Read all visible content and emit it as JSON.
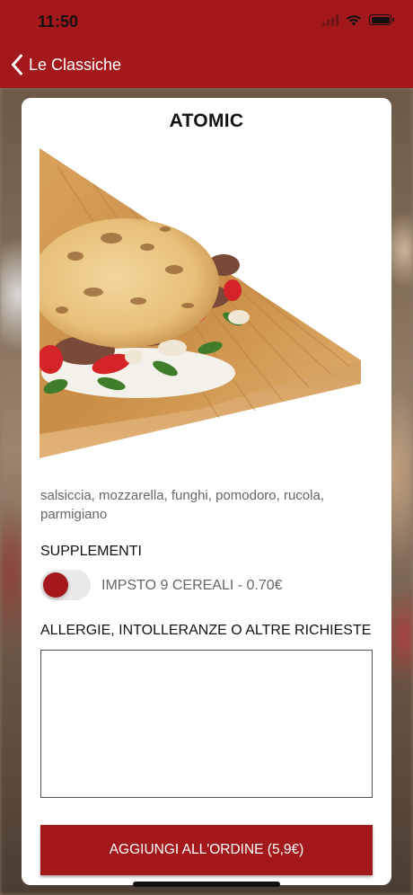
{
  "status_bar": {
    "time": "11:50",
    "icons": [
      "signal-icon",
      "wifi-icon",
      "battery-icon"
    ]
  },
  "nav": {
    "back_icon": "chevron-left-icon",
    "back_label": "Le Classiche"
  },
  "product": {
    "name": "ATOMIC",
    "image": "piadina-on-cutting-board",
    "description": "salsiccia, mozzarella, funghi, pomodoro, rucola, parmigiano"
  },
  "supplements": {
    "heading": "SUPPLEMENTI",
    "items": [
      {
        "label": "IMPSTO 9 CEREALI - 0.70€",
        "enabled": false
      }
    ]
  },
  "allergies": {
    "heading": "ALLERGIE, INTOLLERANZE O ALTRE RICHIESTE",
    "value": "",
    "placeholder": ""
  },
  "add_button": {
    "label": "AGGIUNGI ALL'ORDINE (5,9€)"
  },
  "colors": {
    "brand_red": "#a3181b",
    "card_bg": "#ffffff",
    "text_muted": "#666666"
  }
}
